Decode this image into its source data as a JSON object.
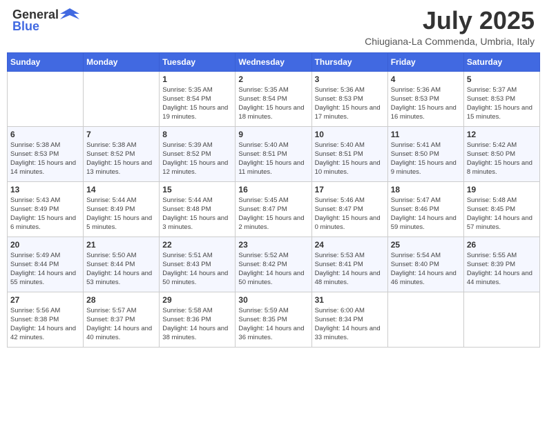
{
  "header": {
    "logo": {
      "general": "General",
      "blue": "Blue",
      "logo_alt": "GeneralBlue logo"
    },
    "month": "July 2025",
    "location": "Chiugiana-La Commenda, Umbria, Italy"
  },
  "calendar": {
    "days_of_week": [
      "Sunday",
      "Monday",
      "Tuesday",
      "Wednesday",
      "Thursday",
      "Friday",
      "Saturday"
    ],
    "weeks": [
      [
        {
          "day": "",
          "info": ""
        },
        {
          "day": "",
          "info": ""
        },
        {
          "day": "1",
          "sunrise": "Sunrise: 5:35 AM",
          "sunset": "Sunset: 8:54 PM",
          "daylight": "Daylight: 15 hours and 19 minutes."
        },
        {
          "day": "2",
          "sunrise": "Sunrise: 5:35 AM",
          "sunset": "Sunset: 8:54 PM",
          "daylight": "Daylight: 15 hours and 18 minutes."
        },
        {
          "day": "3",
          "sunrise": "Sunrise: 5:36 AM",
          "sunset": "Sunset: 8:53 PM",
          "daylight": "Daylight: 15 hours and 17 minutes."
        },
        {
          "day": "4",
          "sunrise": "Sunrise: 5:36 AM",
          "sunset": "Sunset: 8:53 PM",
          "daylight": "Daylight: 15 hours and 16 minutes."
        },
        {
          "day": "5",
          "sunrise": "Sunrise: 5:37 AM",
          "sunset": "Sunset: 8:53 PM",
          "daylight": "Daylight: 15 hours and 15 minutes."
        }
      ],
      [
        {
          "day": "6",
          "sunrise": "Sunrise: 5:38 AM",
          "sunset": "Sunset: 8:53 PM",
          "daylight": "Daylight: 15 hours and 14 minutes."
        },
        {
          "day": "7",
          "sunrise": "Sunrise: 5:38 AM",
          "sunset": "Sunset: 8:52 PM",
          "daylight": "Daylight: 15 hours and 13 minutes."
        },
        {
          "day": "8",
          "sunrise": "Sunrise: 5:39 AM",
          "sunset": "Sunset: 8:52 PM",
          "daylight": "Daylight: 15 hours and 12 minutes."
        },
        {
          "day": "9",
          "sunrise": "Sunrise: 5:40 AM",
          "sunset": "Sunset: 8:51 PM",
          "daylight": "Daylight: 15 hours and 11 minutes."
        },
        {
          "day": "10",
          "sunrise": "Sunrise: 5:40 AM",
          "sunset": "Sunset: 8:51 PM",
          "daylight": "Daylight: 15 hours and 10 minutes."
        },
        {
          "day": "11",
          "sunrise": "Sunrise: 5:41 AM",
          "sunset": "Sunset: 8:50 PM",
          "daylight": "Daylight: 15 hours and 9 minutes."
        },
        {
          "day": "12",
          "sunrise": "Sunrise: 5:42 AM",
          "sunset": "Sunset: 8:50 PM",
          "daylight": "Daylight: 15 hours and 8 minutes."
        }
      ],
      [
        {
          "day": "13",
          "sunrise": "Sunrise: 5:43 AM",
          "sunset": "Sunset: 8:49 PM",
          "daylight": "Daylight: 15 hours and 6 minutes."
        },
        {
          "day": "14",
          "sunrise": "Sunrise: 5:44 AM",
          "sunset": "Sunset: 8:49 PM",
          "daylight": "Daylight: 15 hours and 5 minutes."
        },
        {
          "day": "15",
          "sunrise": "Sunrise: 5:44 AM",
          "sunset": "Sunset: 8:48 PM",
          "daylight": "Daylight: 15 hours and 3 minutes."
        },
        {
          "day": "16",
          "sunrise": "Sunrise: 5:45 AM",
          "sunset": "Sunset: 8:47 PM",
          "daylight": "Daylight: 15 hours and 2 minutes."
        },
        {
          "day": "17",
          "sunrise": "Sunrise: 5:46 AM",
          "sunset": "Sunset: 8:47 PM",
          "daylight": "Daylight: 15 hours and 0 minutes."
        },
        {
          "day": "18",
          "sunrise": "Sunrise: 5:47 AM",
          "sunset": "Sunset: 8:46 PM",
          "daylight": "Daylight: 14 hours and 59 minutes."
        },
        {
          "day": "19",
          "sunrise": "Sunrise: 5:48 AM",
          "sunset": "Sunset: 8:45 PM",
          "daylight": "Daylight: 14 hours and 57 minutes."
        }
      ],
      [
        {
          "day": "20",
          "sunrise": "Sunrise: 5:49 AM",
          "sunset": "Sunset: 8:44 PM",
          "daylight": "Daylight: 14 hours and 55 minutes."
        },
        {
          "day": "21",
          "sunrise": "Sunrise: 5:50 AM",
          "sunset": "Sunset: 8:44 PM",
          "daylight": "Daylight: 14 hours and 53 minutes."
        },
        {
          "day": "22",
          "sunrise": "Sunrise: 5:51 AM",
          "sunset": "Sunset: 8:43 PM",
          "daylight": "Daylight: 14 hours and 50 minutes."
        },
        {
          "day": "23",
          "sunrise": "Sunrise: 5:52 AM",
          "sunset": "Sunset: 8:42 PM",
          "daylight": "Daylight: 14 hours and 50 minutes."
        },
        {
          "day": "24",
          "sunrise": "Sunrise: 5:53 AM",
          "sunset": "Sunset: 8:41 PM",
          "daylight": "Daylight: 14 hours and 48 minutes."
        },
        {
          "day": "25",
          "sunrise": "Sunrise: 5:54 AM",
          "sunset": "Sunset: 8:40 PM",
          "daylight": "Daylight: 14 hours and 46 minutes."
        },
        {
          "day": "26",
          "sunrise": "Sunrise: 5:55 AM",
          "sunset": "Sunset: 8:39 PM",
          "daylight": "Daylight: 14 hours and 44 minutes."
        }
      ],
      [
        {
          "day": "27",
          "sunrise": "Sunrise: 5:56 AM",
          "sunset": "Sunset: 8:38 PM",
          "daylight": "Daylight: 14 hours and 42 minutes."
        },
        {
          "day": "28",
          "sunrise": "Sunrise: 5:57 AM",
          "sunset": "Sunset: 8:37 PM",
          "daylight": "Daylight: 14 hours and 40 minutes."
        },
        {
          "day": "29",
          "sunrise": "Sunrise: 5:58 AM",
          "sunset": "Sunset: 8:36 PM",
          "daylight": "Daylight: 14 hours and 38 minutes."
        },
        {
          "day": "30",
          "sunrise": "Sunrise: 5:59 AM",
          "sunset": "Sunset: 8:35 PM",
          "daylight": "Daylight: 14 hours and 36 minutes."
        },
        {
          "day": "31",
          "sunrise": "Sunrise: 6:00 AM",
          "sunset": "Sunset: 8:34 PM",
          "daylight": "Daylight: 14 hours and 33 minutes."
        },
        {
          "day": "",
          "info": ""
        },
        {
          "day": "",
          "info": ""
        }
      ]
    ]
  }
}
